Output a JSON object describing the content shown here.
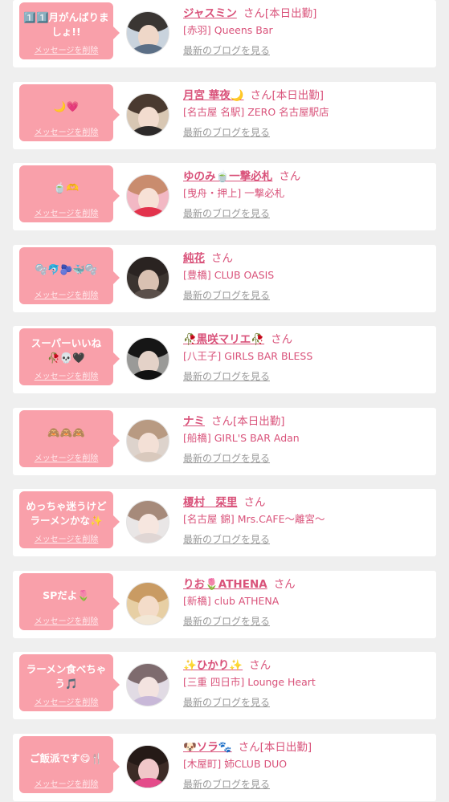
{
  "cards": [
    {
      "message": "1️⃣1️⃣月がんばりましょ!!",
      "delete_label": "メッセージを削除",
      "name": "ジャスミン",
      "honorific": "さん",
      "status": "[本日出勤]",
      "shop": "[赤羽] Queens Bar",
      "blog_label": "最新のブログを見る",
      "avatar": {
        "bg": "#c9d3dd",
        "hair": "#3a3633",
        "skin": "#efd7c8",
        "cloth": "#5c6f86"
      }
    },
    {
      "message": "🌙💗",
      "delete_label": "メッセージを削除",
      "name": "月宮 華夜🌙",
      "honorific": "さん",
      "status": "[本日出勤]",
      "shop": "[名古屋 名駅] ZERO 名古屋駅店",
      "blog_label": "最新のブログを見る",
      "avatar": {
        "bg": "#d8c7b3",
        "hair": "#4a3a30",
        "skin": "#f2dccf",
        "cloth": "#2d2a2a"
      }
    },
    {
      "message": "🍵🫶",
      "delete_label": "メッセージを削除",
      "name": "ゆのみ🍵一撃必札",
      "honorific": "さん",
      "status": "",
      "shop": "[曳舟・押上] 一撃必札",
      "blog_label": "最新のブログを見る",
      "avatar": {
        "bg": "#f2b8c4",
        "hair": "#c98c6e",
        "skin": "#f7e1d6",
        "cloth": "#e2334c"
      }
    },
    {
      "message": "🫧🐬🫐🐳🫧",
      "delete_label": "メッセージを削除",
      "name": "純花",
      "honorific": "さん",
      "status": "",
      "shop": "[豊橋] CLUB OASIS",
      "blog_label": "最新のブログを見る",
      "avatar": {
        "bg": "#3b3430",
        "hair": "#2a2321",
        "skin": "#d9c1b2",
        "cloth": "#5a4f4a"
      }
    },
    {
      "message": "スーパーいいね\n🥀💀🖤",
      "delete_label": "メッセージを削除",
      "name": "🥀黒咲マリエ🥀",
      "honorific": "さん",
      "status": "",
      "shop": "[八王子] GIRLS BAR BLESS",
      "blog_label": "最新のブログを見る",
      "avatar": {
        "bg": "#9a9a98",
        "hair": "#161616",
        "skin": "#e4d2c8",
        "cloth": "#111111"
      }
    },
    {
      "message": "🙈🙈🙈",
      "delete_label": "メッセージを削除",
      "name": "ナミ",
      "honorific": "さん",
      "status": "[本日出勤]",
      "shop": "[船橋] GIRL'S BAR Adan",
      "blog_label": "最新のブログを見る",
      "avatar": {
        "bg": "#ddd3cc",
        "hair": "#b89a82",
        "skin": "#f3e0d6",
        "cloth": "#d9c9bd"
      }
    },
    {
      "message": "めっちゃ迷うけど\nラーメンかな✨",
      "delete_label": "メッセージを削除",
      "name": "榎村　栞里",
      "honorific": "さん",
      "status": "",
      "shop": "[名古屋 錦] Mrs.CAFE～離宮～",
      "blog_label": "最新のブログを見る",
      "avatar": {
        "bg": "#e9e6e6",
        "hair": "#a68a7a",
        "skin": "#f6e6df",
        "cloth": "#e0d6d4"
      }
    },
    {
      "message": "SPだよ🌷",
      "delete_label": "メッセージを削除",
      "name": "りお🌷ATHENA",
      "honorific": "さん",
      "status": "",
      "shop": "[新橋] club ATHENA",
      "blog_label": "最新のブログを見る",
      "avatar": {
        "bg": "#e7cfa4",
        "hair": "#c99b63",
        "skin": "#f4dcc9",
        "cloth": "#f2e7d6"
      }
    },
    {
      "message": "ラーメン食べちゃう🎵",
      "delete_label": "メッセージを削除",
      "name": "✨ひかり✨",
      "honorific": "さん",
      "status": "",
      "shop": "[三重 四日市] Lounge Heart",
      "blog_label": "最新のブログを見る",
      "avatar": {
        "bg": "#e1dbe4",
        "hair": "#7e6b6e",
        "skin": "#f3e3e0",
        "cloth": "#c8b8d8"
      }
    },
    {
      "message": "ご飯派です😋🍴",
      "delete_label": "メッセージを削除",
      "name": "🐶ソラ🐾",
      "honorific": "さん",
      "status": "[本日出勤]",
      "shop": "[木屋町] 姉CLUB DUO",
      "blog_label": "最新のブログを見る",
      "avatar": {
        "bg": "#3c2b26",
        "hair": "#251a17",
        "skin": "#f0c7c9",
        "cloth": "#e44b8a"
      }
    }
  ]
}
